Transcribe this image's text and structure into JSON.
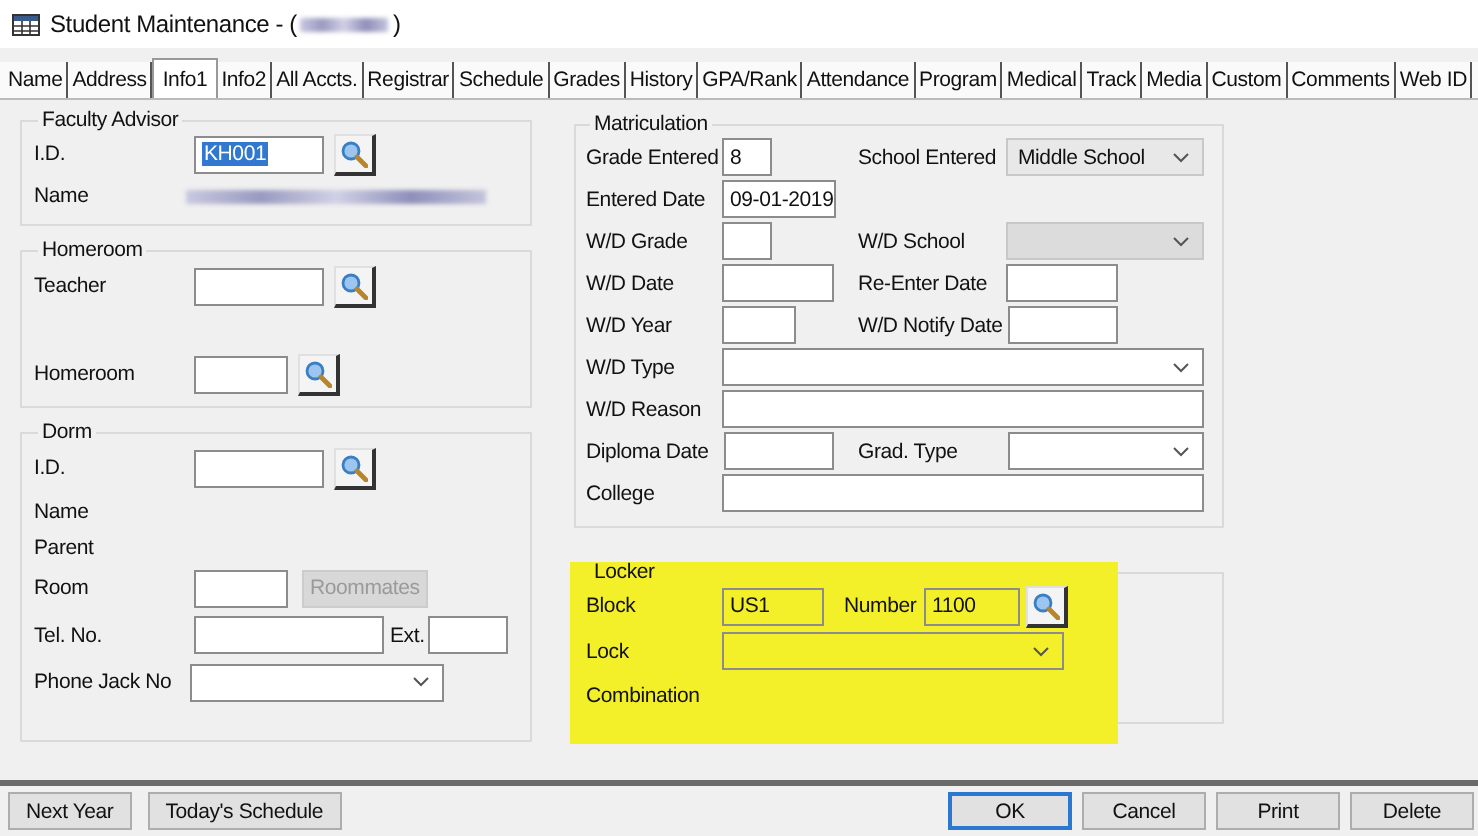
{
  "window": {
    "title": "Student Maintenance - (",
    "title_end": ")"
  },
  "tabs": [
    {
      "label": "Name",
      "selected": false
    },
    {
      "label": "Address",
      "selected": false
    },
    {
      "label": "Info1",
      "selected": true
    },
    {
      "label": "Info2",
      "selected": false
    },
    {
      "label": "All Accts.",
      "selected": false
    },
    {
      "label": "Registrar",
      "selected": false
    },
    {
      "label": "Schedule",
      "selected": false
    },
    {
      "label": "Grades",
      "selected": false
    },
    {
      "label": "History",
      "selected": false
    },
    {
      "label": "GPA/Rank",
      "selected": false
    },
    {
      "label": "Attendance",
      "selected": false
    },
    {
      "label": "Program",
      "selected": false
    },
    {
      "label": "Medical",
      "selected": false
    },
    {
      "label": "Track",
      "selected": false
    },
    {
      "label": "Media",
      "selected": false
    },
    {
      "label": "Custom",
      "selected": false
    },
    {
      "label": "Comments",
      "selected": false
    },
    {
      "label": "Web ID",
      "selected": false
    }
  ],
  "faculty_advisor": {
    "title": "Faculty Advisor",
    "id_label": "I.D.",
    "id_value": "KH001",
    "id_value_selected": true,
    "name_label": "Name"
  },
  "homeroom": {
    "title": "Homeroom",
    "teacher_label": "Teacher",
    "homeroom_label": "Homeroom"
  },
  "dorm": {
    "title": "Dorm",
    "id_label": "I.D.",
    "name_label": "Name",
    "parent_label": "Parent",
    "room_label": "Room",
    "roommates_button": {
      "label": "Roommates",
      "disabled": true
    },
    "tel_label": "Tel. No.",
    "ext_label": "Ext.",
    "phone_jack_label": "Phone Jack No"
  },
  "matriculation": {
    "title": "Matriculation",
    "grade_entered": {
      "label": "Grade Entered",
      "value": "8"
    },
    "school_entered": {
      "label": "School Entered",
      "value": "Middle School"
    },
    "entered_date": {
      "label": "Entered Date",
      "value": "09-01-2019"
    },
    "wd_grade": {
      "label": "W/D Grade"
    },
    "wd_school": {
      "label": "W/D School",
      "disabled": true
    },
    "wd_date": {
      "label": "W/D Date"
    },
    "reenter_date": {
      "label": "Re-Enter Date"
    },
    "wd_year": {
      "label": "W/D Year"
    },
    "wd_notify_date": {
      "label": "W/D Notify Date"
    },
    "wd_type": {
      "label": "W/D Type"
    },
    "wd_reason": {
      "label": "W/D Reason"
    },
    "diploma_date": {
      "label": "Diploma Date"
    },
    "grad_type": {
      "label": "Grad. Type"
    },
    "college": {
      "label": "College"
    }
  },
  "locker": {
    "title": "Locker",
    "highlighted": true,
    "block": {
      "label": "Block",
      "value": "US1"
    },
    "number": {
      "label": "Number",
      "value": "1100"
    },
    "lock": {
      "label": "Lock"
    },
    "combination_label": "Combination"
  },
  "footer": {
    "left_buttons": [
      "Next Year",
      "Today's Schedule"
    ],
    "right_buttons": [
      {
        "label": "OK",
        "default": true
      },
      {
        "label": "Cancel",
        "default": false
      },
      {
        "label": "Print",
        "default": false
      },
      {
        "label": "Delete",
        "default": false
      }
    ]
  }
}
